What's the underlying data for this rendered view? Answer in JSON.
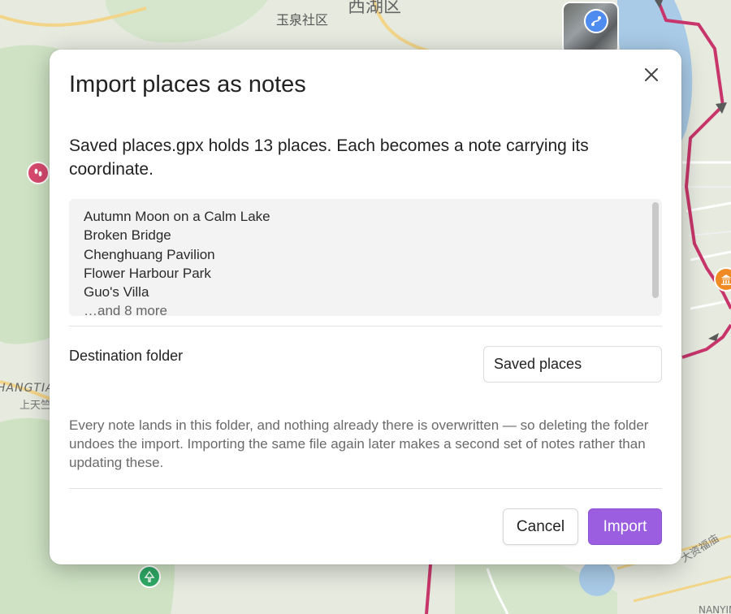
{
  "map": {
    "labels": {
      "district": "西湖区",
      "community": "玉泉社区",
      "area_latin": "HANGTIA",
      "area_cn": "上天竺",
      "road": "大资福庙",
      "area_bottom": "NANYING"
    },
    "icons": {
      "thumbnail_badge": "route-icon",
      "red_pin": "footprints-icon",
      "green_pin": "tree-icon",
      "orange_pin": "museum-icon"
    },
    "colors": {
      "route": "#c8356a",
      "red_pin": "#d84a6f",
      "green_pin": "#2eaa66",
      "orange_pin": "#ef8a24",
      "water": "#a9cbe8"
    }
  },
  "dialog": {
    "title": "Import places as notes",
    "close_icon": "close-icon",
    "intro": "Saved places.gpx holds 13 places. Each becomes a note carrying its coordinate.",
    "places": [
      "Autumn Moon on a Calm Lake",
      "Broken Bridge",
      "Chenghuang Pavilion",
      "Flower Harbour Park",
      "Guo's Villa"
    ],
    "more_text": "…and 8 more",
    "destination_label": "Destination folder",
    "destination_value": "Saved places",
    "note": "Every note lands in this folder, and nothing already there is overwritten — so deleting the folder undoes the import. Importing the same file again later makes a second set of notes rather than updating these.",
    "cancel_label": "Cancel",
    "import_label": "Import",
    "colors": {
      "accent": "#9b5ee0"
    }
  }
}
